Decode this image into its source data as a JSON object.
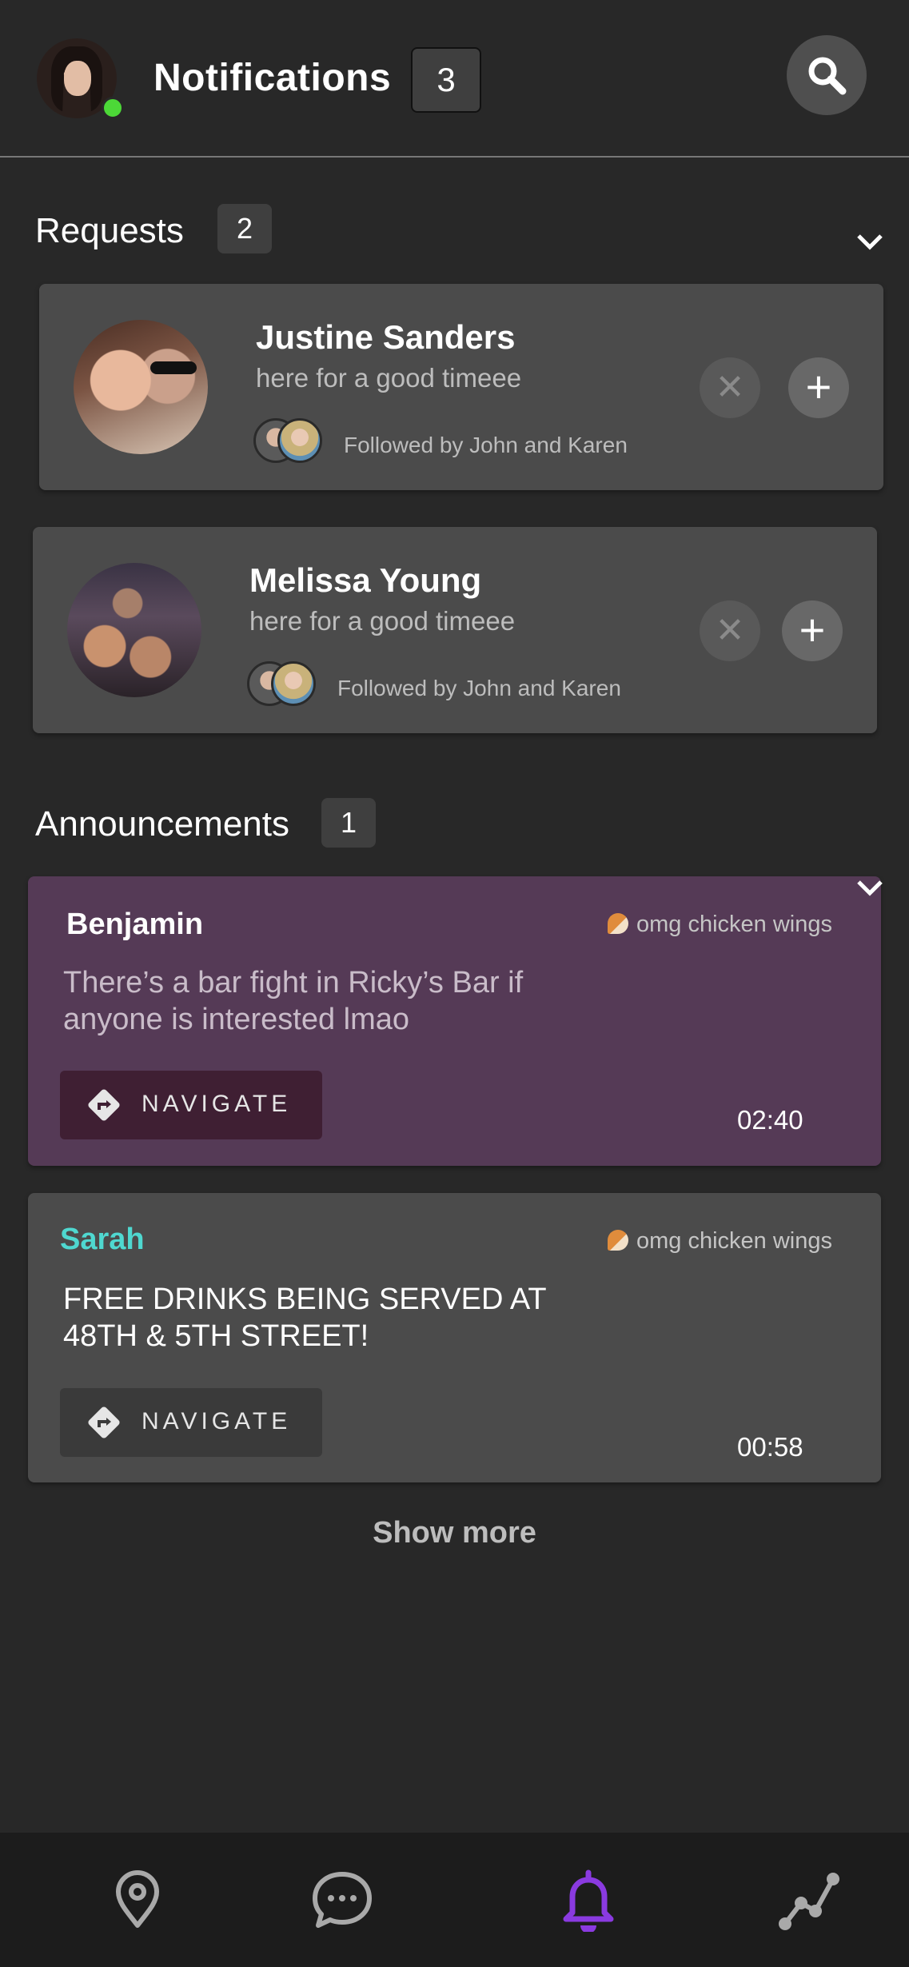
{
  "header": {
    "title": "Notifications",
    "badge_count": "3",
    "avatar": "user-avatar",
    "status": "online",
    "search_icon": "search-icon"
  },
  "requests": {
    "title": "Requests",
    "count": "2",
    "items": [
      {
        "name": "Justine Sanders",
        "bio": "here for a good timeee",
        "followed_by": "Followed by John and Karen"
      },
      {
        "name": "Melissa Young",
        "bio": "here for a good timeee",
        "followed_by": "Followed by John and Karen"
      }
    ]
  },
  "announcements": {
    "title": "Announcements",
    "count": "1",
    "items": [
      {
        "author": "Benjamin",
        "author_color": "#ffffff",
        "tag": "omg chicken wings",
        "text": "There’s a bar fight in Ricky’s Bar if anyone is interested lmao",
        "button": "NAVIGATE",
        "time": "02:40",
        "background": "#553a56"
      },
      {
        "author": "Sarah",
        "author_color": "#4fd8d0",
        "tag": "omg chicken wings",
        "text": "FREE DRINKS BEING SERVED AT 48TH & 5TH STREET!",
        "button": "NAVIGATE",
        "time": "00:58",
        "background": "#4b4b4b"
      }
    ]
  },
  "show_more": "Show more",
  "bottom_nav": {
    "tabs": [
      "map-pin-icon",
      "chat-bubble-icon",
      "bell-icon",
      "activity-graph-icon"
    ],
    "active": "bell-icon",
    "accent": "#8a3ae0"
  }
}
